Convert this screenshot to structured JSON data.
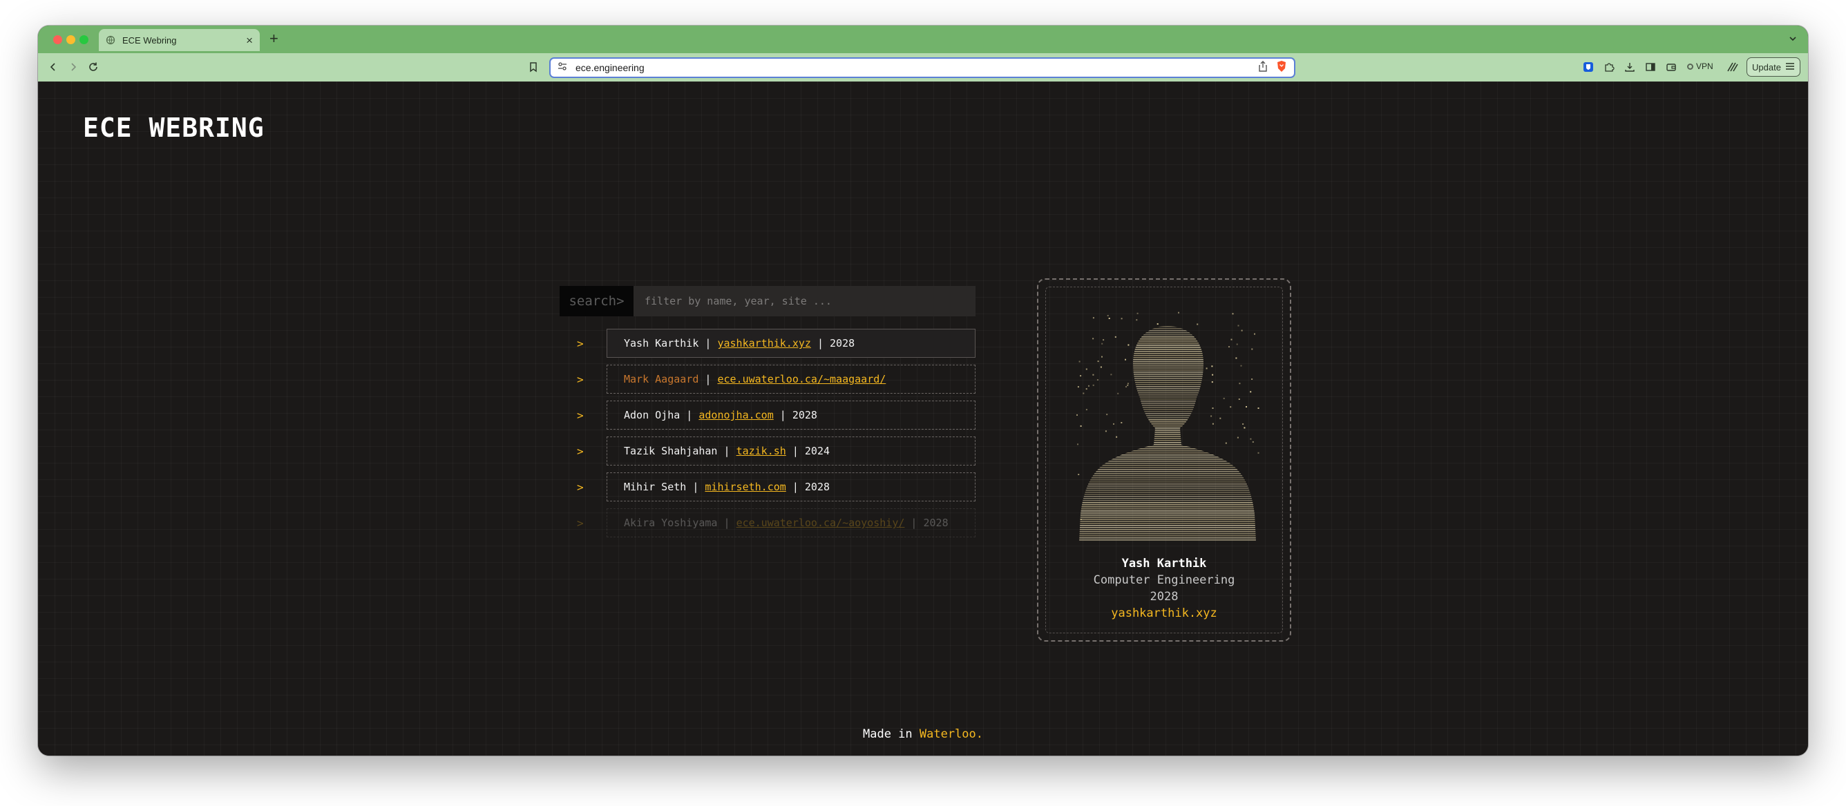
{
  "browser": {
    "tab_title": "ECE Webring",
    "new_tab_label": "+",
    "url": "ece.engineering",
    "vpn_label": "VPN",
    "update_label": "Update"
  },
  "site": {
    "title": "ECE WEBRING",
    "accent_color": "#f5b820"
  },
  "search": {
    "label": "search>",
    "placeholder": "filter by name, year, site ..."
  },
  "members": [
    {
      "arrow": ">",
      "name": "Yash Karthik",
      "site": "yashkarthik.xyz",
      "year": "2028"
    },
    {
      "arrow": ">",
      "name": "Mark Aagaard",
      "site": "ece.uwaterloo.ca/~maagaard/",
      "year": ""
    },
    {
      "arrow": ">",
      "name": "Adon Ojha",
      "site": "adonojha.com",
      "year": "2028"
    },
    {
      "arrow": ">",
      "name": "Tazik Shahjahan",
      "site": "tazik.sh",
      "year": "2024"
    },
    {
      "arrow": ">",
      "name": "Mihir Seth",
      "site": "mihirseth.com",
      "year": "2028"
    },
    {
      "arrow": ">",
      "name": "Akira Yoshiyama",
      "site": "ece.uwaterloo.ca/~aoyoshiy/",
      "year": "2028"
    }
  ],
  "profile": {
    "name": "Yash Karthik",
    "program": "Computer Engineering",
    "year": "2028",
    "site": "yashkarthik.xyz"
  },
  "footer": {
    "prefix": "Made in ",
    "place": "Waterloo."
  }
}
